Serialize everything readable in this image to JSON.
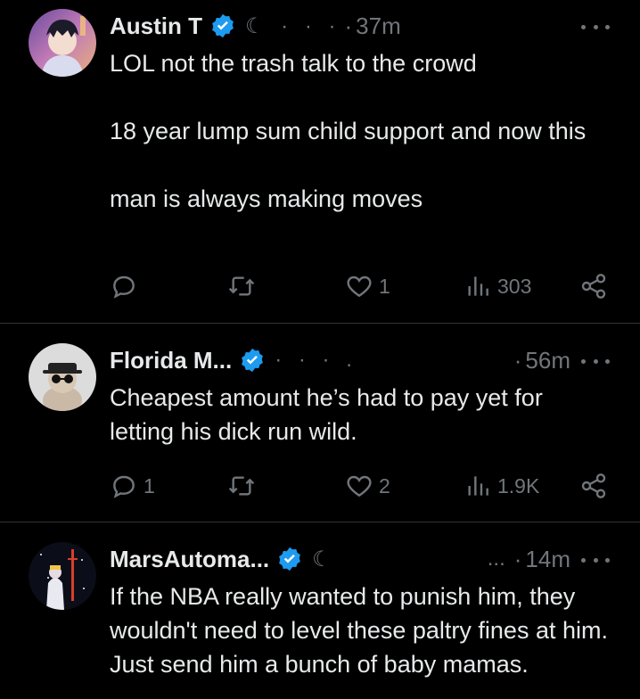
{
  "colors": {
    "background": "#000000",
    "text": "#e7e9ea",
    "muted": "#71767b",
    "verified": "#1d9bf0",
    "divider": "#2f3336"
  },
  "tweets": [
    {
      "name": "Austin T",
      "handle_partial": "☾ ·  ·  ·",
      "separator": "·",
      "time": "37m",
      "text": [
        "LOL not the trash talk to the crowd",
        "18 year lump sum child support and now this",
        "man is always making moves"
      ],
      "actions": {
        "replies": "",
        "retweets": "",
        "likes": "1",
        "views": "303"
      }
    },
    {
      "name": "Florida M...",
      "handle_partial": "·  ·  ·  .",
      "separator": "·",
      "time": "56m",
      "text": [
        "Cheapest amount he’s had to pay yet for letting his dick run wild."
      ],
      "actions": {
        "replies": "1",
        "retweets": "",
        "likes": "2",
        "views": "1.9K"
      }
    },
    {
      "name": "MarsAutoma...",
      "handle_partial": "☾",
      "handle_tail": "...",
      "separator": "·",
      "time": "14m",
      "text": [
        "If the NBA really wanted to punish him, they wouldn't need to level these paltry fines at him. Just send him a bunch of baby mamas."
      ],
      "actions": {
        "replies": "",
        "retweets": "",
        "likes": "",
        "views": ""
      }
    }
  ],
  "icons": {
    "verified": "verified-badge-icon",
    "more": "more-options-icon",
    "reply": "reply-icon",
    "retweet": "retweet-icon",
    "like": "heart-icon",
    "views": "views-chart-icon",
    "share": "share-icon"
  }
}
